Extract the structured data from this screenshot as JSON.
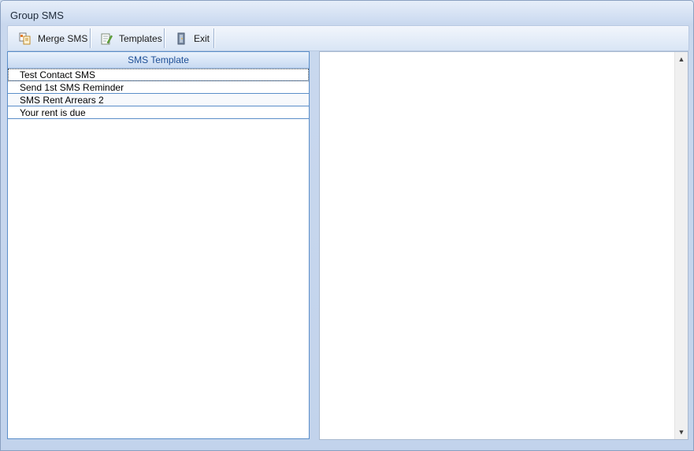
{
  "window": {
    "title": "Group SMS"
  },
  "toolbar": {
    "buttons": [
      {
        "label": "Merge SMS",
        "icon": "merge-sms-icon"
      },
      {
        "label": "Templates",
        "icon": "templates-icon"
      },
      {
        "label": "Exit",
        "icon": "exit-door-icon"
      }
    ]
  },
  "template_grid": {
    "header": "SMS Template",
    "rows": [
      "Test Contact SMS",
      "Send 1st SMS Reminder",
      "SMS Rent Arrears 2",
      "Your rent is due"
    ],
    "selected_index": 0
  },
  "preview": {
    "text": ""
  },
  "colors": {
    "accent": "#5b8ec9",
    "header_text": "#1e4f96",
    "window_bg": "#c9d8ee"
  }
}
